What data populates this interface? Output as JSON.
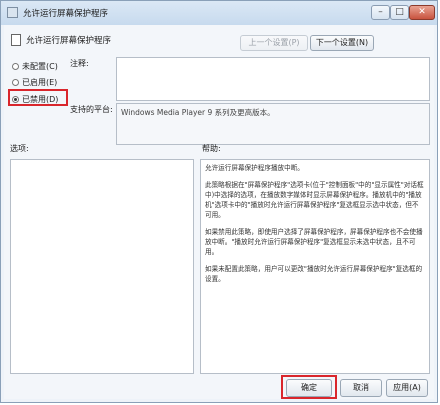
{
  "window": {
    "title": "允许运行屏幕保护程序",
    "buttons": {
      "minimize": "–",
      "maximize": "□",
      "close": "✕"
    }
  },
  "header": {
    "setting_title": "允许运行屏幕保护程序",
    "prev_label": "上一个设置(P)",
    "next_label": "下一个设置(N)"
  },
  "options": {
    "not_configured": "未配置(C)",
    "enabled": "已启用(E)",
    "disabled": "已禁用(D)",
    "selected": "disabled"
  },
  "comment_label": "注释:",
  "supported_label": "支持的平台:",
  "supported_value": "Windows Media Player 9 系列及更高版本。",
  "options_label": "选项:",
  "help_label": "帮助:",
  "help": {
    "p1": "允许运行屏幕保护程序播放中断。",
    "p2": "此策略根据在\"屏幕保护程序\"选项卡(位于\"控制面板\"中的\"显示属性\"对话框中)中选择的选项，在播放数字媒体时显示屏幕保护程序。播放机中的\"播放机\"选项卡中的\"播放时允许运行屏幕保护程序\"复选框显示选中状态，但不可用。",
    "p3": "如果禁用此策略，即使用户选择了屏幕保护程序，屏幕保护程序也不会使播放中断。\"播放时允许运行屏幕保护程序\"复选框显示未选中状态，且不可用。",
    "p4": "如果未配置此策略，用户可以更改\"播放时允许运行屏幕保护程序\"复选框的设置。"
  },
  "footer": {
    "ok_label": "确定",
    "cancel_label": "取消",
    "apply_label": "应用(A)"
  },
  "colors": {
    "highlight": "#d9262c",
    "accent": "#c7daee"
  }
}
